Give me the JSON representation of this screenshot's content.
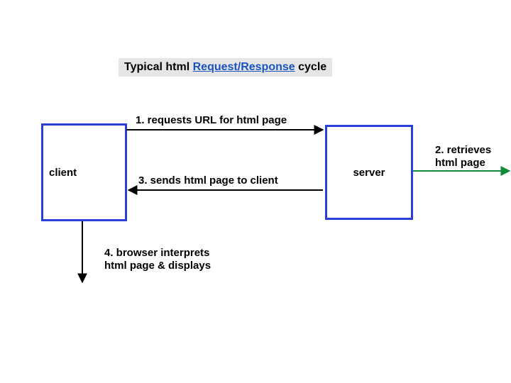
{
  "title": {
    "part1": "Typical html",
    "linked": "Request/Response",
    "part2": "cycle"
  },
  "nodes": {
    "client": "client",
    "server": "server"
  },
  "steps": {
    "s1": "1. requests URL for html page",
    "s2": "2. retrieves\nhtml page",
    "s3": "3. sends html page to client",
    "s4": "4. browser interprets\nhtml page & displays"
  }
}
